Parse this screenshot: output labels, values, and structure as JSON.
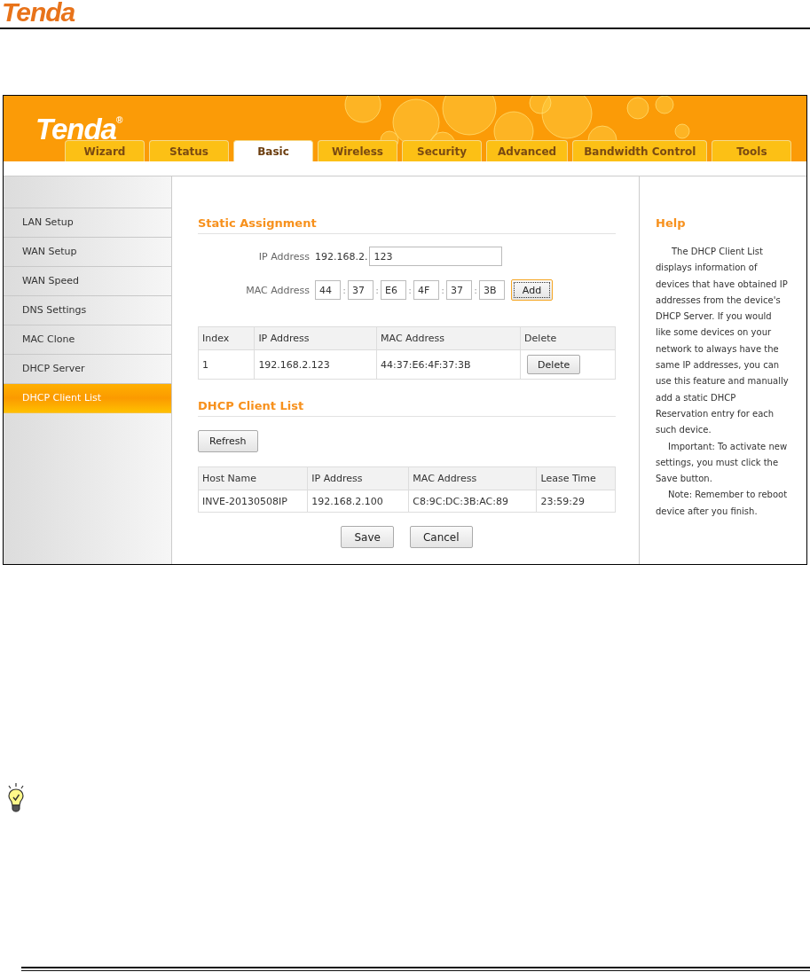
{
  "document_header": {
    "logo": "Tenda"
  },
  "router_ui": {
    "logo": "Tenda$^{®}$",
    "tabs": [
      {
        "label": "Wizard",
        "selected": false
      },
      {
        "label": "Status",
        "selected": false
      },
      {
        "label": "Basic",
        "selected": true
      },
      {
        "label": "Wireless",
        "selected": false
      },
      {
        "label": "Security",
        "selected": false
      },
      {
        "label": "Advanced",
        "selected": false
      },
      {
        "label": "Bandwidth Control",
        "selected": false
      },
      {
        "label": "Tools",
        "selected": false
      }
    ],
    "sidebar": {
      "items": [
        {
          "label": "LAN Setup",
          "selected": false
        },
        {
          "label": "WAN Setup",
          "selected": false
        },
        {
          "label": "WAN Speed",
          "selected": false
        },
        {
          "label": "DNS Settings",
          "selected": false
        },
        {
          "label": "MAC Clone",
          "selected": false
        },
        {
          "label": "DHCP Server",
          "selected": false
        },
        {
          "label": "DHCP Client List",
          "selected": true
        }
      ]
    },
    "static_assignment": {
      "title": "Static Assignment",
      "ip_label": "IP Address",
      "ip_prefix": "192.168.2.",
      "ip_value": "123",
      "mac_label": "MAC Address",
      "mac_octets": [
        "44",
        "37",
        "E6",
        "4F",
        "37",
        "3B"
      ],
      "mac_separators": [
        ":",
        ":",
        ":",
        ":",
        ":"
      ],
      "add_button": {
        "label": "Add",
        "focused": true
      }
    },
    "reservations": {
      "columns": [
        "Index",
        "IP Address",
        "MAC Address",
        "Delete"
      ],
      "rows": [
        {
          "index": "1",
          "ip": "192.168.2.123",
          "mac": "44:37:E6:4F:37:3B",
          "delete_button": "Delete"
        }
      ]
    },
    "client_list": {
      "title": "DHCP Client List",
      "refresh_button": "Refresh",
      "columns": [
        "Host Name",
        "IP Address",
        "MAC Address",
        "Lease Time"
      ],
      "rows": [
        [
          "INVE-20130508IP",
          "192.168.2.100",
          "C8:9C:DC:3B:AC:89",
          "23:59:29"
        ]
      ]
    },
    "buttons": [
      "Save",
      "Cancel"
    ],
    "help": {
      "title": "Help",
      "paragraphs": [
        "The DHCP Client List displays information of devices that have obtained IP addresses from the device's DHCP Server. If you would like some devices on your network to always have the same IP addresses, you can use this feature and manually add a static DHCP Reservation entry for each such device.",
        "Important: To activate new settings, you must click the Save button.",
        "Note: Remember to reboot device after you finish."
      ]
    }
  }
}
